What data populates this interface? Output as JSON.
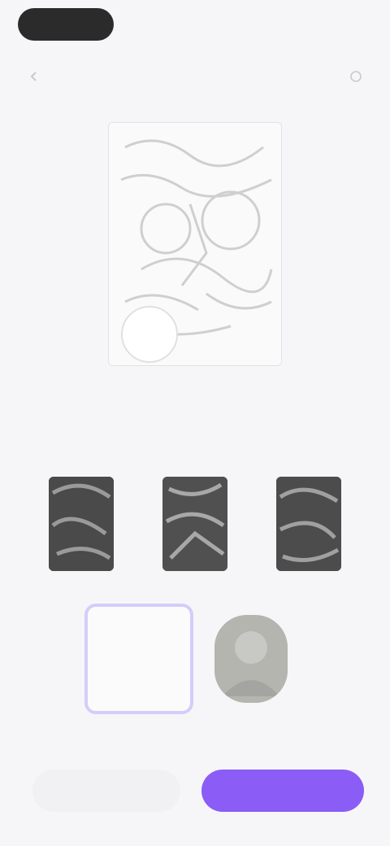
{
  "header": {
    "title": "",
    "back_icon": "back-arrow-icon",
    "more_icon": "more-icon"
  },
  "preview": {
    "hint": "",
    "link_a": "",
    "link_b": ""
  },
  "templates": {
    "section_label": "",
    "items": [
      "",
      "",
      ""
    ]
  },
  "options": {
    "photo_caption": ""
  },
  "footer": {
    "note": "",
    "secondary_label": "",
    "primary_label": ""
  },
  "colors": {
    "accent": "#8b5cf6",
    "accent_light": "#d6ccfa",
    "background": "#f6f6f8"
  }
}
